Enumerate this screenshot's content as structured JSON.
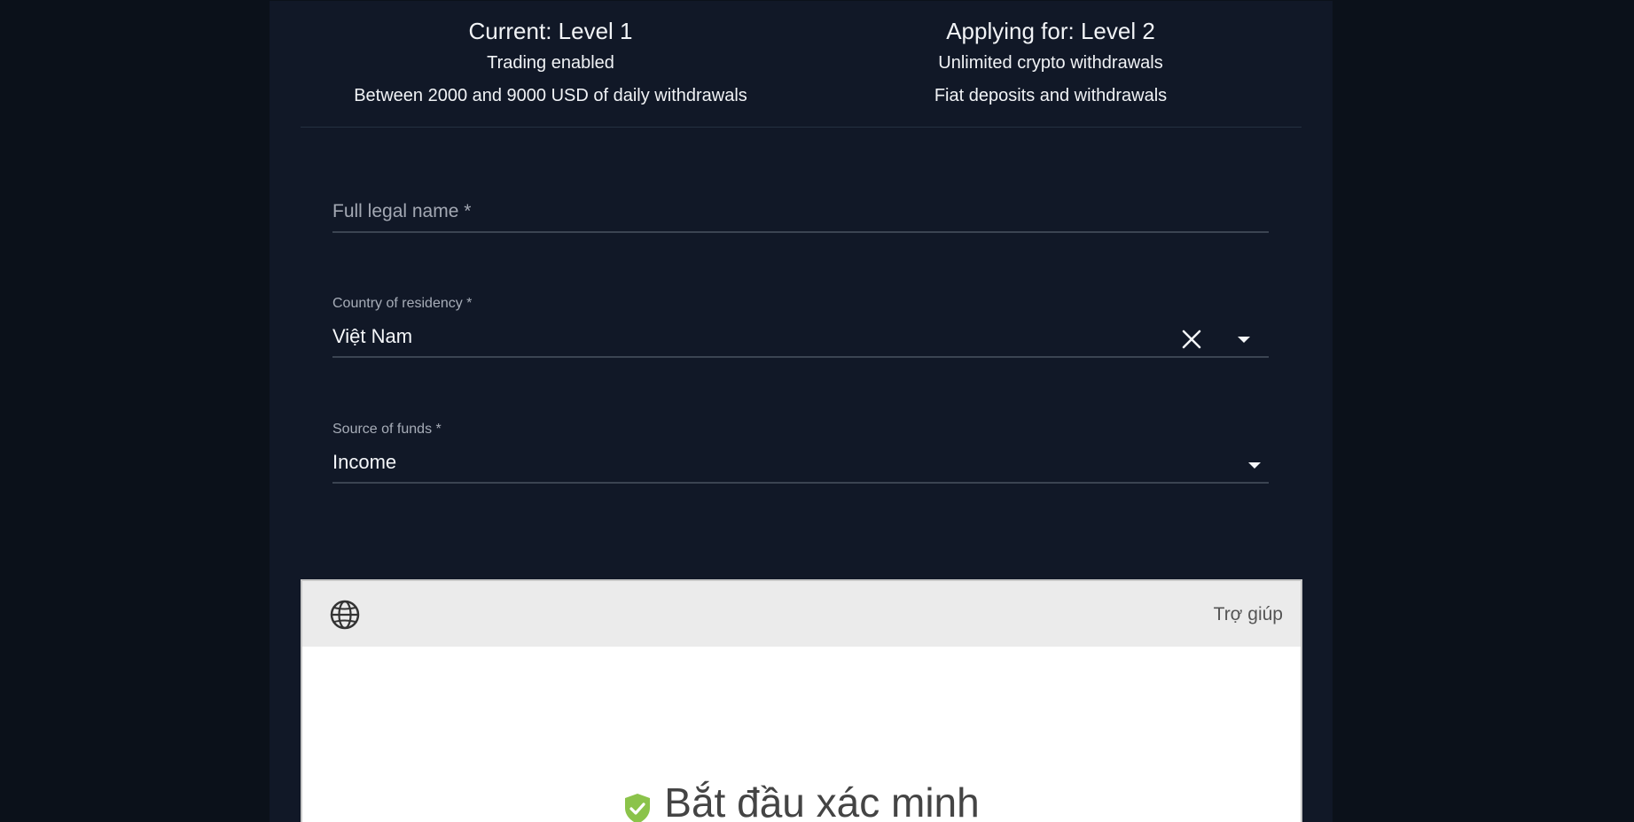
{
  "levels": {
    "current": {
      "title": "Current: Level 1",
      "features": [
        "Trading enabled",
        "Between 2000 and 9000 USD of daily withdrawals"
      ]
    },
    "applying": {
      "title": "Applying for: Level 2",
      "features": [
        "Unlimited crypto withdrawals",
        "Fiat deposits and withdrawals"
      ]
    }
  },
  "form": {
    "full_name": {
      "placeholder": "Full legal name *",
      "value": ""
    },
    "country": {
      "label": "Country of residency *",
      "value": "Việt Nam"
    },
    "source_of_funds": {
      "label": "Source of funds *",
      "value": "Income"
    }
  },
  "verification_widget": {
    "help_label": "Trợ giúp",
    "title": "Bắt đầu xác minh",
    "language_icon": "globe-icon",
    "status_icon": "shield-check-icon",
    "status_color": "#8bc34a"
  }
}
